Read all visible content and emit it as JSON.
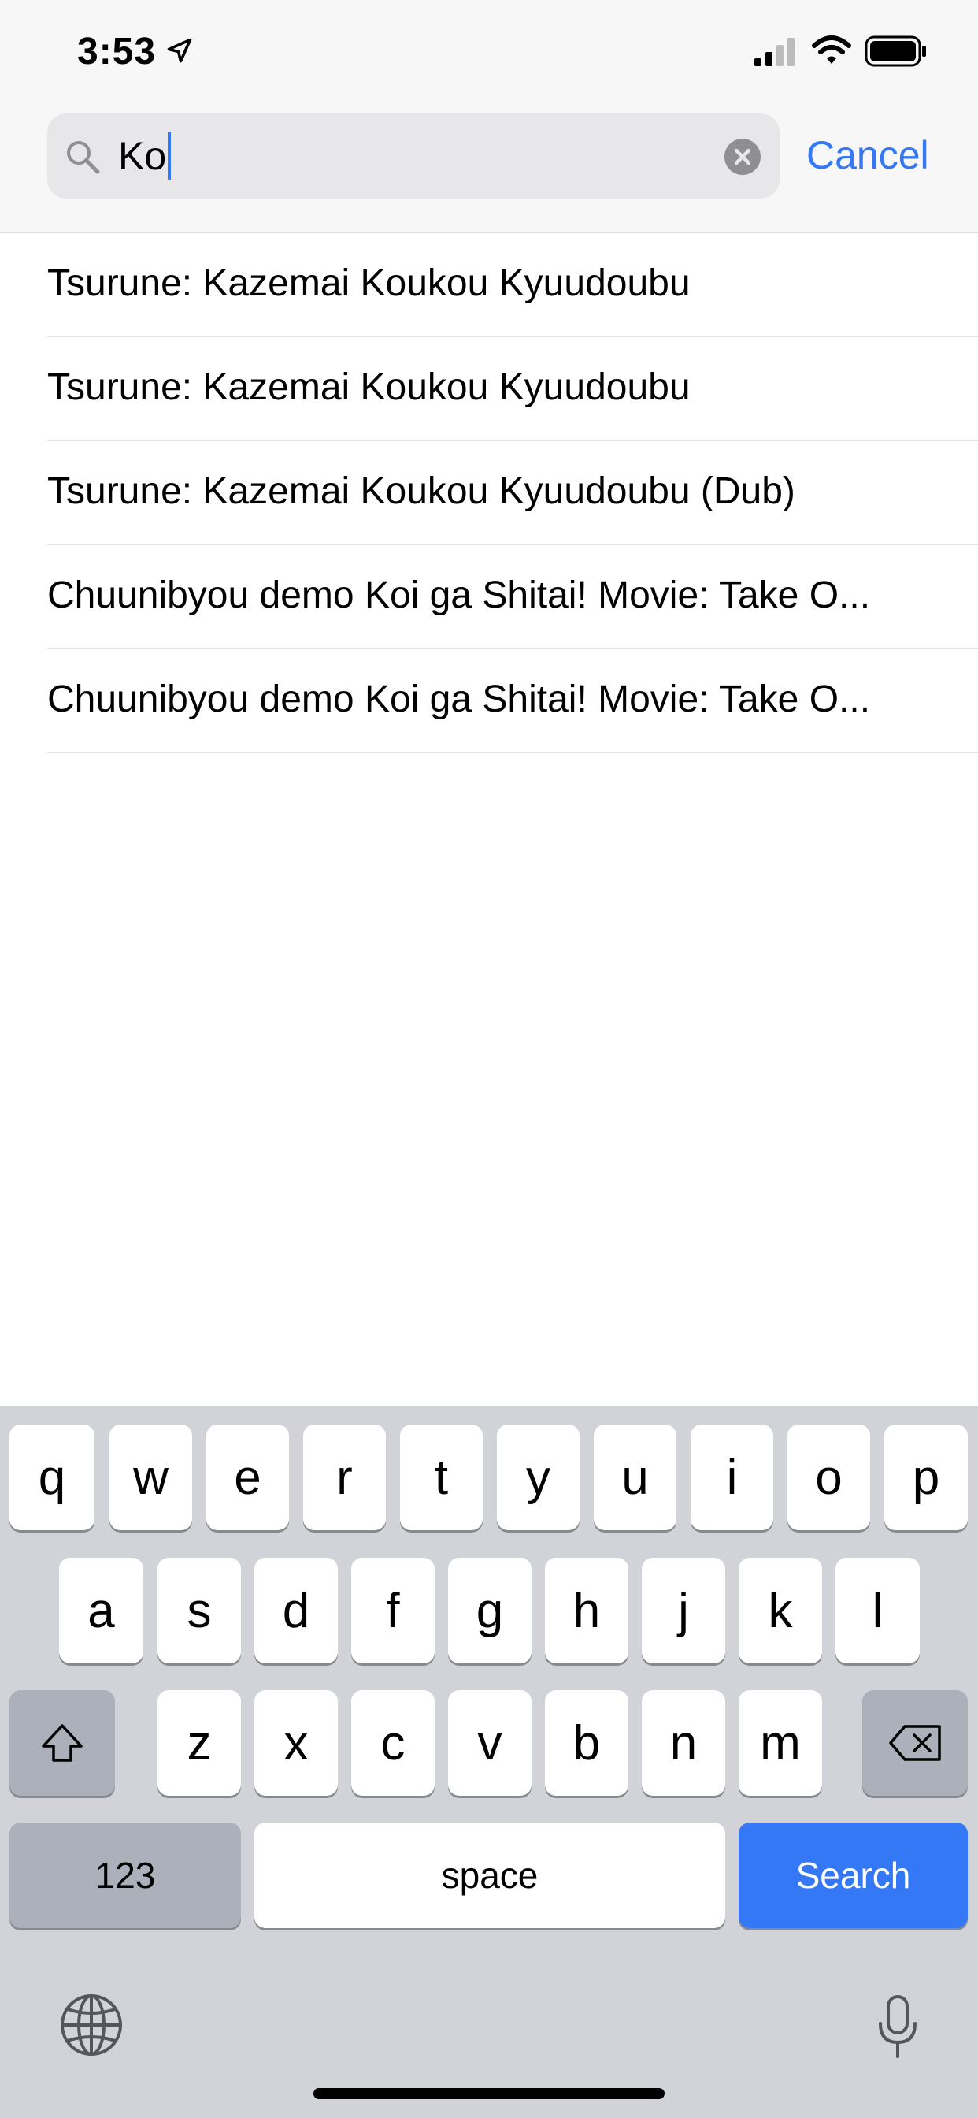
{
  "status_bar": {
    "time": "3:53",
    "location_icon": "location-arrow-icon",
    "signal_icon": "cellular-signal-icon",
    "wifi_icon": "wifi-icon",
    "battery_icon": "battery-icon"
  },
  "search": {
    "value": "Ko",
    "cancel_label": "Cancel"
  },
  "results": [
    "Tsurune: Kazemai Koukou Kyuudoubu",
    "Tsurune: Kazemai Koukou Kyuudoubu",
    "Tsurune: Kazemai Koukou Kyuudoubu (Dub)",
    "Chuunibyou demo Koi ga Shitai! Movie: Take O...",
    "Chuunibyou demo Koi ga Shitai! Movie: Take O..."
  ],
  "keyboard": {
    "row1": [
      "q",
      "w",
      "e",
      "r",
      "t",
      "y",
      "u",
      "i",
      "o",
      "p"
    ],
    "row2": [
      "a",
      "s",
      "d",
      "f",
      "g",
      "h",
      "j",
      "k",
      "l"
    ],
    "row3": [
      "z",
      "x",
      "c",
      "v",
      "b",
      "n",
      "m"
    ],
    "numbers_label": "123",
    "space_label": "space",
    "search_label": "Search"
  },
  "colors": {
    "accent": "#3478f6",
    "keyboard_bg": "#d1d3d9",
    "header_bg": "#f7f7f7"
  }
}
